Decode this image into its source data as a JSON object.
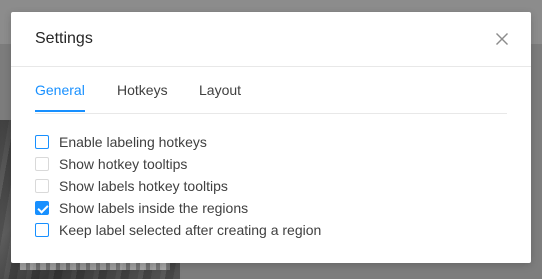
{
  "dialog": {
    "title": "Settings",
    "close_icon": "close-icon"
  },
  "tabs": [
    {
      "label": "General",
      "active": true
    },
    {
      "label": "Hotkeys",
      "active": false
    },
    {
      "label": "Layout",
      "active": false
    }
  ],
  "options": [
    {
      "label": "Enable labeling hotkeys",
      "checked": false
    },
    {
      "label": "Show hotkey tooltips",
      "checked": false
    },
    {
      "label": "Show labels hotkey tooltips",
      "checked": false
    },
    {
      "label": "Show labels inside the regions",
      "checked": true
    },
    {
      "label": "Keep label selected after creating a region",
      "checked": false
    }
  ],
  "colors": {
    "accent": "#1890ff",
    "text": "#404040",
    "title": "#262626",
    "divider": "#e8e8e8",
    "overlay": "#7c7c7c"
  }
}
